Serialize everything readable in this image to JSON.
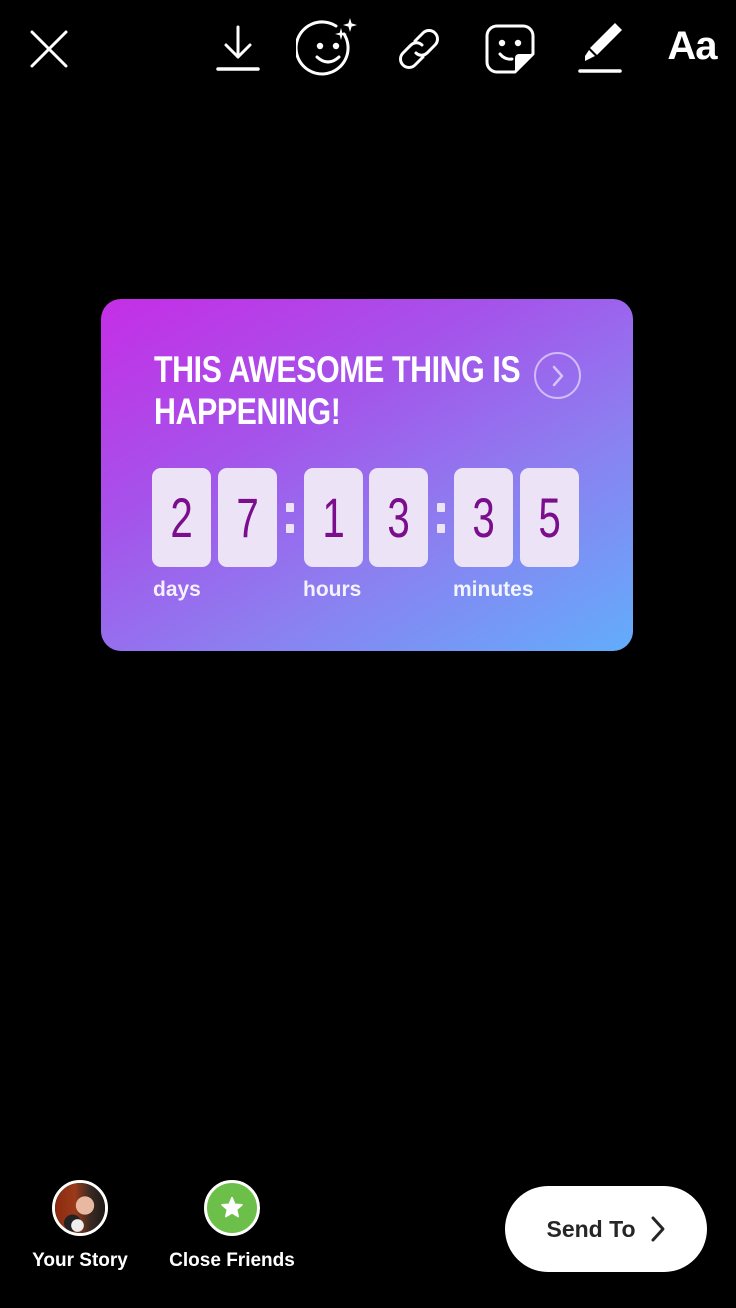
{
  "toolbar": {
    "close": {
      "icon": "close-icon"
    },
    "download": {
      "icon": "download-icon"
    },
    "effects": {
      "icon": "face-effects-icon"
    },
    "link": {
      "icon": "link-icon"
    },
    "stickers": {
      "icon": "sticker-icon"
    },
    "draw": {
      "icon": "draw-marker-icon"
    },
    "text": {
      "label": "Aa",
      "icon": "text-icon"
    }
  },
  "countdown_sticker": {
    "title": "THIS AWESOME THING IS HAPPENING!",
    "arrow_icon": "chevron-right-circle-icon",
    "gradient": [
      "#c52ee6",
      "#8c7ff0",
      "#62adfb"
    ],
    "digit_color": "#7a0e8c",
    "days": [
      "2",
      "7"
    ],
    "hours": [
      "1",
      "3"
    ],
    "minutes": [
      "3",
      "5"
    ],
    "labels": {
      "days": "days",
      "hours": "hours",
      "minutes": "minutes"
    }
  },
  "bottom": {
    "your_story": {
      "label": "Your Story"
    },
    "close_friends": {
      "label": "Close Friends",
      "icon": "star-icon",
      "color": "#6cc04a"
    },
    "send_to": {
      "label": "Send To",
      "icon": "chevron-right-icon"
    }
  }
}
